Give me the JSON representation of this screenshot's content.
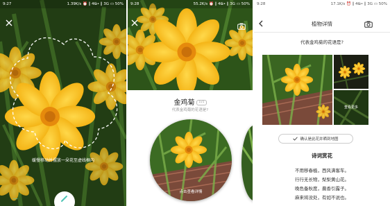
{
  "colors": {
    "accent": "#4fc5b5",
    "flower": "#f6b815",
    "flower_center": "#e68a0c",
    "leaf": "#3f7a25"
  },
  "screens": [
    {
      "status": {
        "time": "9:27",
        "right": "1.39K/s ⏰ ∥ 4G̶• ∥ 3G ▭ 50%"
      },
      "close_icon": "close-icon",
      "hint": "缓慢移动并摆放一朵花至虚线框内",
      "bottom_left_text": "—",
      "bottom_circle_icon": "pencil-icon"
    },
    {
      "status": {
        "time": "9:28",
        "right": "55.2K/s ⏰ ∥ 4G̶• ∥ 3G ▭ 50%"
      },
      "close_icon": "close-icon",
      "camera_icon": "camera-icon",
      "plant_name": "金鸡菊",
      "plant_level": "Lv1",
      "question": "代表金鸡菊的花语是?",
      "circle_caption": "点击查看详情"
    },
    {
      "status": {
        "time": "9:28",
        "right": "17.1K/s ⏰ ∥ 4G̶• ∥ 3G ▭ 50%"
      },
      "back_icon": "back-arrow-icon",
      "title": "植物详情",
      "camera_icon": "camera-icon",
      "question": "代表金鸡菊的花语是?",
      "more_label": "查看更多",
      "confirm_label": "确认是此花并晒到地图",
      "poem_title": "诗词赏花",
      "poem_lines": [
        "不用移春植，西风满客车。",
        "行行无长物，梨梨黄山花。",
        "晚色备秋度，晨香引露子。",
        "麻来将没处，有如不说也。"
      ]
    }
  ]
}
